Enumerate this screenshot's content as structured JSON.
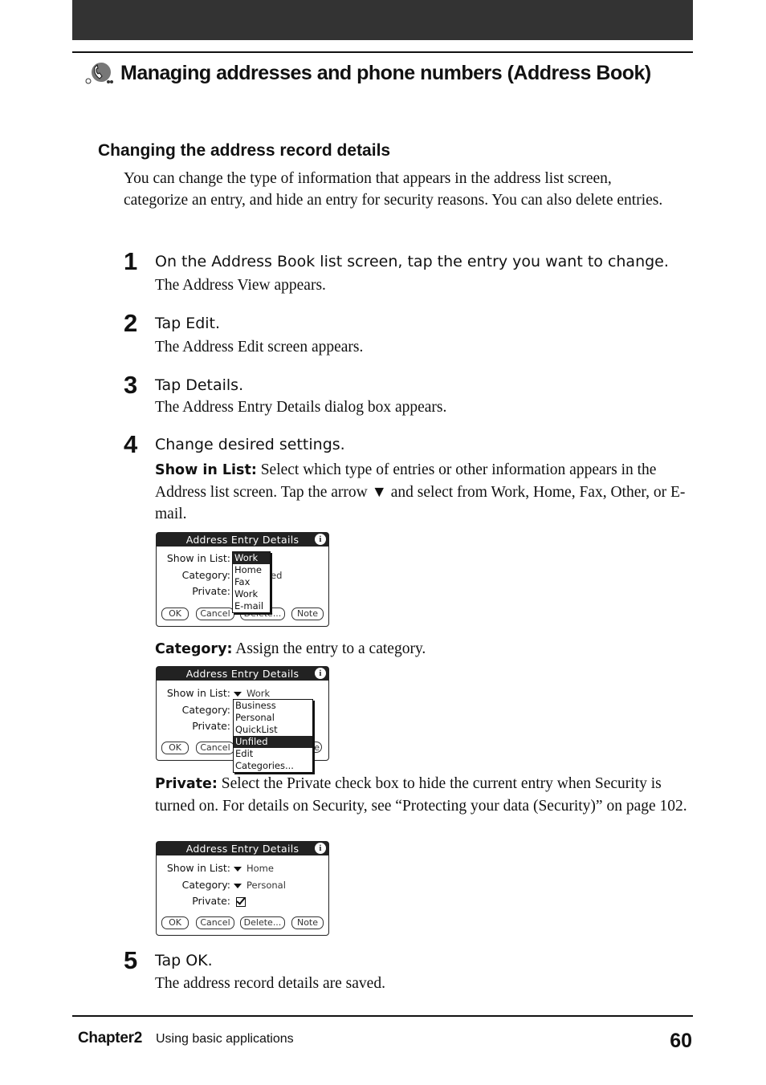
{
  "header": {
    "title": "Managing addresses and phone numbers (Address Book)",
    "icon": "address-book-phone-icon"
  },
  "section": {
    "heading": "Changing the address record details",
    "intro": "You can change the type of information that appears in the address list screen, categorize an entry, and hide an entry for security reasons. You can also delete entries."
  },
  "steps": [
    {
      "num": "1",
      "head": "On the Address Book list screen, tap the entry you want to change.",
      "desc": "The Address View appears."
    },
    {
      "num": "2",
      "head": "Tap Edit.",
      "desc": "The Address Edit screen appears."
    },
    {
      "num": "3",
      "head": "Tap Details.",
      "desc": "The Address Entry Details dialog box appears."
    },
    {
      "num": "4",
      "head": "Change desired settings."
    },
    {
      "num": "5",
      "head": "Tap OK.",
      "desc": "The address record details are saved."
    }
  ],
  "settings": {
    "show": {
      "label": "Show in List:",
      "text": "Select which type of entries or other information appears in the Address list screen. Tap the arrow ▼ and select from Work, Home, Fax, Other, or E-mail."
    },
    "category": {
      "label": "Category:",
      "text": "Assign the entry to a category."
    },
    "private": {
      "label": "Private:",
      "text": "Select the Private check box to hide the current entry when Security is turned on. For details on Security, see “Protecting your data (Security)” on page 102."
    }
  },
  "dialog": {
    "title": "Address Entry Details",
    "info": "i",
    "show_label": "Show in List:",
    "category_label": "Category:",
    "private_label": "Private:",
    "ok": "OK",
    "cancel": "Cancel",
    "delete": "Delete...",
    "note": "Note"
  },
  "dialog1": {
    "popup": [
      "Work",
      "Home",
      "Fax",
      "Work",
      "E-mail"
    ],
    "selected": "Work",
    "behind": "ed"
  },
  "dialog2": {
    "show_value": "Work",
    "popup": [
      "Business",
      "Personal",
      "QuickList",
      "Unfiled",
      "Edit Categories..."
    ],
    "selected": "Unfiled"
  },
  "dialog3": {
    "show_value": "Home",
    "category_value": "Personal",
    "private_checked": true
  },
  "footer": {
    "chapter": "Chapter2",
    "subtitle": "Using basic applications",
    "page": "60"
  }
}
